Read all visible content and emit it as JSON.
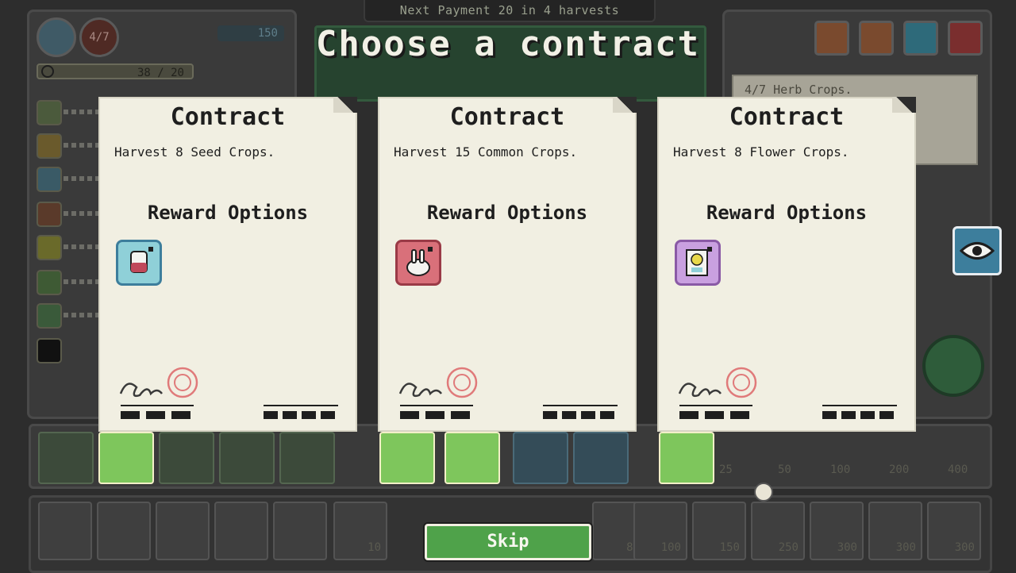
{
  "header": {
    "next_payment": "Next Payment 20 in 4 harvests",
    "title": "Choose a contract"
  },
  "status": {
    "herb_count": "4/7",
    "coins": "150",
    "progress": "38 / 20"
  },
  "side_note": "4/7 Herb Crops.",
  "contracts": [
    {
      "title": "Contract",
      "description": "Harvest 8 Seed Crops.",
      "reward_heading": "Reward Options",
      "reward_icon": "potion-card-icon",
      "reward_color": "#8fd0d8"
    },
    {
      "title": "Contract",
      "description": "Harvest 15 Common Crops.",
      "reward_heading": "Reward Options",
      "reward_icon": "rabbit-card-icon",
      "reward_color": "#d9707a"
    },
    {
      "title": "Contract",
      "description": "Harvest 8 Flower Crops.",
      "reward_heading": "Reward Options",
      "reward_icon": "smiley-note-card-icon",
      "reward_color": "#c9a0e0"
    }
  ],
  "hand_prices": [
    "25",
    "50",
    "100",
    "200",
    "400"
  ],
  "slot_prices": [
    "10",
    "80",
    "100",
    "150",
    "250",
    "300",
    "300",
    "300"
  ],
  "skip_label": "Skip",
  "colors": {
    "skip_bg": "#4fa24a",
    "card_bg": "#f1efe2",
    "eye_btn": "#3d7e9c"
  }
}
